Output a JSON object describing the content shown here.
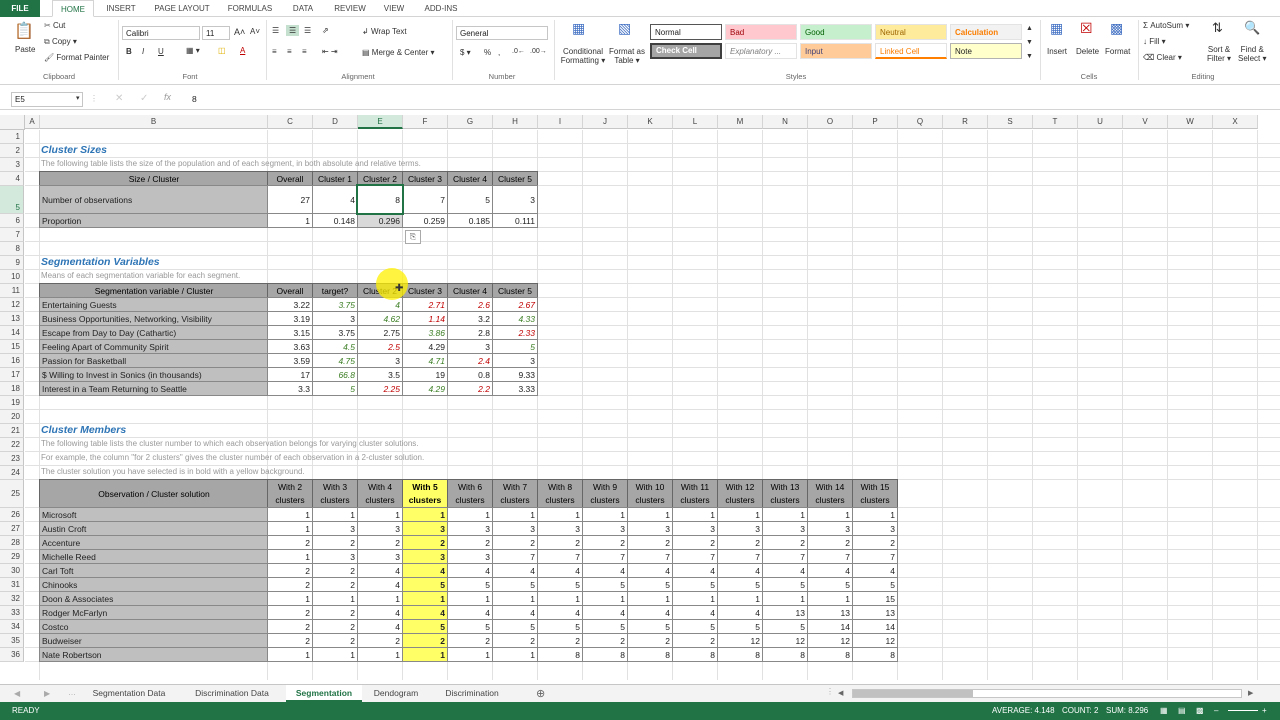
{
  "tabs": [
    "FILE",
    "HOME",
    "INSERT",
    "PAGE LAYOUT",
    "FORMULAS",
    "DATA",
    "REVIEW",
    "VIEW",
    "ADD-INS"
  ],
  "ribbon": {
    "paste": "Paste",
    "cut": "Cut",
    "copy": "Copy",
    "format_painter": "Format Painter",
    "font_name": "Calibri",
    "font_size": "11",
    "wrap_text": "Wrap Text",
    "merge_center": "Merge & Center",
    "number_format": "General",
    "cond_fmt": "Conditional",
    "cond_fmt2": "Formatting",
    "fmt_table": "Format as",
    "fmt_table2": "Table",
    "styles": [
      "Normal",
      "Bad",
      "Good",
      "Neutral",
      "Calculation",
      "Check Cell",
      "Explanatory ...",
      "Input",
      "Linked Cell",
      "Note"
    ],
    "insert": "Insert",
    "delete": "Delete",
    "format": "Format",
    "autosum": "AutoSum",
    "fill": "Fill",
    "clear": "Clear",
    "sort": "Sort &",
    "sort2": "Filter",
    "find": "Find &",
    "find2": "Select",
    "groups": [
      "Clipboard",
      "Font",
      "Alignment",
      "Number",
      "Styles",
      "Cells",
      "Editing"
    ]
  },
  "formula_bar": {
    "name_box": "E5",
    "fx": "fx",
    "value": "8"
  },
  "columns": [
    "A",
    "B",
    "C",
    "D",
    "E",
    "F",
    "G",
    "H",
    "I",
    "J",
    "K",
    "L",
    "M",
    "N",
    "O",
    "P",
    "Q",
    "R",
    "S",
    "T",
    "U",
    "V",
    "W",
    "X"
  ],
  "rows": [
    "1",
    "2",
    "3",
    "4",
    "5",
    "6",
    "7",
    "8",
    "9",
    "10",
    "11",
    "12",
    "13",
    "14",
    "15",
    "16",
    "17",
    "18",
    "19",
    "20",
    "21",
    "22",
    "23",
    "24",
    "25",
    "26",
    "27",
    "28",
    "29",
    "30",
    "31",
    "32",
    "33",
    "34",
    "35",
    "36"
  ],
  "sheet": {
    "cluster_sizes_title": "Cluster Sizes",
    "cluster_sizes_desc": "The following table lists the size of the population and of each segment, in both absolute and relative terms.",
    "size_headers": [
      "Size / Cluster",
      "Overall",
      "Cluster 1",
      "Cluster 2",
      "Cluster 3",
      "Cluster 4",
      "Cluster 5"
    ],
    "size_rows": [
      {
        "label": "Number of observations",
        "vals": [
          "27",
          "4",
          "8",
          "7",
          "5",
          "3"
        ]
      },
      {
        "label": "Proportion",
        "vals": [
          "1",
          "0.148",
          "0.296",
          "0.259",
          "0.185",
          "0.111"
        ]
      }
    ],
    "seg_title": "Segmentation Variables",
    "seg_desc": "Means of each segmentation variable for each segment.",
    "seg_headers": [
      "Segmentation variable / Cluster",
      "Overall",
      "target?",
      "Cluster 2",
      "Cluster 3",
      "Cluster 4",
      "Cluster 5"
    ],
    "seg_rows": [
      {
        "label": "Entertaining Guests",
        "vals": [
          "3.22",
          "3.75",
          "4",
          "2.71",
          "2.6",
          "2.67"
        ],
        "cls": [
          "",
          "grn",
          "grn",
          "red",
          "red",
          "red"
        ]
      },
      {
        "label": "Business Opportunities, Networking, Visibility",
        "vals": [
          "3.19",
          "3",
          "4.62",
          "1.14",
          "3.2",
          "4.33"
        ],
        "cls": [
          "",
          "",
          "grn",
          "red",
          "",
          "grn"
        ]
      },
      {
        "label": "Escape from Day to Day (Cathartic)",
        "vals": [
          "3.15",
          "3.75",
          "2.75",
          "3.86",
          "2.8",
          "2.33"
        ],
        "cls": [
          "",
          "",
          "",
          "grn",
          "",
          "red"
        ]
      },
      {
        "label": "Feeling Apart of Community Spirit",
        "vals": [
          "3.63",
          "4.5",
          "2.5",
          "4.29",
          "3",
          "5"
        ],
        "cls": [
          "",
          "grn",
          "red",
          "",
          "",
          "grn"
        ]
      },
      {
        "label": "Passion for Basketball",
        "vals": [
          "3.59",
          "4.75",
          "3",
          "4.71",
          "2.4",
          "3"
        ],
        "cls": [
          "",
          "grn",
          "",
          "grn",
          "red",
          ""
        ]
      },
      {
        "label": "$ Willing to Invest in Sonics (in thousands)",
        "vals": [
          "17",
          "66.8",
          "3.5",
          "19",
          "0.8",
          "9.33"
        ],
        "cls": [
          "",
          "grn",
          "",
          "",
          "",
          ""
        ]
      },
      {
        "label": "Interest in  a Team Returning to Seattle",
        "vals": [
          "3.3",
          "5",
          "2.25",
          "4.29",
          "2.2",
          "3.33"
        ],
        "cls": [
          "",
          "grn",
          "red",
          "grn",
          "red",
          ""
        ]
      }
    ],
    "members_title": "Cluster Members",
    "members_desc1": "The following table lists the cluster number to which each observation belongs for varying cluster solutions.",
    "members_desc2": "For example, the column \"for 2 clusters\" gives the cluster number of each observation in a 2-cluster solution.",
    "members_desc3": "The cluster solution you have selected is in bold with a yellow background.",
    "mem_header_label": "Observation / Cluster solution",
    "mem_headers": [
      "With 2",
      "With 3",
      "With 4",
      "With 5",
      "With 6",
      "With 7",
      "With 8",
      "With 9",
      "With 10",
      "With 11",
      "With 12",
      "With 13",
      "With 14",
      "With 15"
    ],
    "mem_headers2": "clusters",
    "mem_rows": [
      {
        "label": "Microsoft",
        "vals": [
          "1",
          "1",
          "1",
          "1",
          "1",
          "1",
          "1",
          "1",
          "1",
          "1",
          "1",
          "1",
          "1",
          "1"
        ]
      },
      {
        "label": "Austin Croft",
        "vals": [
          "1",
          "3",
          "3",
          "3",
          "3",
          "3",
          "3",
          "3",
          "3",
          "3",
          "3",
          "3",
          "3",
          "3"
        ]
      },
      {
        "label": "Accenture",
        "vals": [
          "2",
          "2",
          "2",
          "2",
          "2",
          "2",
          "2",
          "2",
          "2",
          "2",
          "2",
          "2",
          "2",
          "2"
        ]
      },
      {
        "label": "Michelle Reed",
        "vals": [
          "1",
          "3",
          "3",
          "3",
          "3",
          "7",
          "7",
          "7",
          "7",
          "7",
          "7",
          "7",
          "7",
          "7"
        ]
      },
      {
        "label": "Carl Toft",
        "vals": [
          "2",
          "2",
          "4",
          "4",
          "4",
          "4",
          "4",
          "4",
          "4",
          "4",
          "4",
          "4",
          "4",
          "4"
        ]
      },
      {
        "label": "Chinooks",
        "vals": [
          "2",
          "2",
          "4",
          "5",
          "5",
          "5",
          "5",
          "5",
          "5",
          "5",
          "5",
          "5",
          "5",
          "5"
        ]
      },
      {
        "label": "Doon & Associates",
        "vals": [
          "1",
          "1",
          "1",
          "1",
          "1",
          "1",
          "1",
          "1",
          "1",
          "1",
          "1",
          "1",
          "1",
          "15"
        ]
      },
      {
        "label": "Rodger McFarlyn",
        "vals": [
          "2",
          "2",
          "4",
          "4",
          "4",
          "4",
          "4",
          "4",
          "4",
          "4",
          "4",
          "13",
          "13",
          "13"
        ]
      },
      {
        "label": "Costco",
        "vals": [
          "2",
          "2",
          "4",
          "5",
          "5",
          "5",
          "5",
          "5",
          "5",
          "5",
          "5",
          "5",
          "14",
          "14"
        ]
      },
      {
        "label": "Budweiser",
        "vals": [
          "2",
          "2",
          "2",
          "2",
          "2",
          "2",
          "2",
          "2",
          "2",
          "2",
          "12",
          "12",
          "12",
          "12"
        ]
      },
      {
        "label": "Nate Robertson",
        "vals": [
          "1",
          "1",
          "1",
          "1",
          "1",
          "1",
          "8",
          "8",
          "8",
          "8",
          "8",
          "8",
          "8",
          "8"
        ]
      }
    ]
  },
  "sheet_tabs": [
    "Segmentation Data",
    "Discrimination Data",
    "Segmentation",
    "Dendogram",
    "Discrimination"
  ],
  "active_sheet": "Segmentation",
  "status": {
    "ready": "READY",
    "average": "AVERAGE: 4.148",
    "count": "COUNT: 2",
    "sum": "SUM: 8.296"
  }
}
